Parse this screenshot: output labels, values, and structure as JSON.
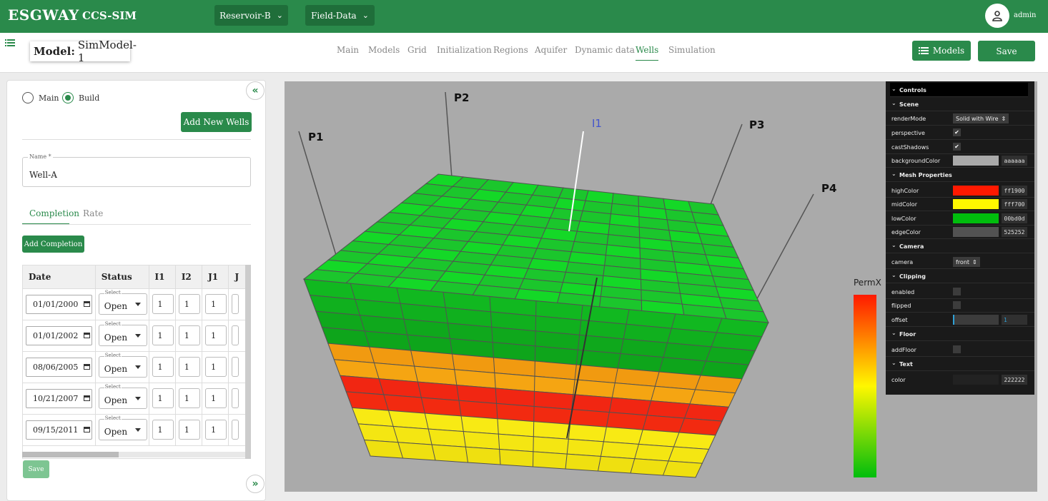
{
  "topbar": {
    "brand": "ESGWAY",
    "subtitle": "CCS-SIM",
    "dropdowns": [
      "Reservoir-B",
      "Field-Data"
    ],
    "user": "admin"
  },
  "navbar": {
    "model_prefix": "Model:",
    "model_name": "SimModel-1",
    "tabs": [
      "Main",
      "Models",
      "Grid",
      "Initialization",
      "Regions",
      "Aquifer",
      "Dynamic data",
      "Wells",
      "Simulation"
    ],
    "active_tab": "Wells",
    "models_button": "Models",
    "save_button": "Save"
  },
  "left": {
    "radio": [
      "Main",
      "Build"
    ],
    "selected_radio": "Build",
    "add_wells": "Add New Wells",
    "name_label": "Name *",
    "name_value": "Well-A",
    "subtabs": [
      "Completion",
      "Rate"
    ],
    "add_completion": "Add Completion",
    "columns": [
      "Date",
      "Status",
      "I1",
      "I2",
      "J1",
      "J"
    ],
    "rows": [
      {
        "date": "01/01/2000",
        "status": "Open",
        "i1": "1",
        "i2": "1",
        "j1": "1"
      },
      {
        "date": "01/01/2002",
        "status": "Open",
        "i1": "1",
        "i2": "1",
        "j1": "1"
      },
      {
        "date": "08/06/2005",
        "status": "Open",
        "i1": "1",
        "i2": "1",
        "j1": "1"
      },
      {
        "date": "10/21/2007",
        "status": "Open",
        "i1": "1",
        "i2": "1",
        "j1": "1"
      },
      {
        "date": "09/15/2011",
        "status": "Open",
        "i1": "1",
        "i2": "1",
        "j1": "1"
      }
    ],
    "select_label": "Select",
    "save": "Save"
  },
  "viewer": {
    "wells": [
      "P1",
      "P2",
      "I1",
      "P3",
      "P4"
    ],
    "colorbar_label": "PermX",
    "colors": {
      "high": "#ff1900",
      "mid": "#fff700",
      "low": "#00bd0d",
      "edge": "#525252",
      "background": "#aaaaaa"
    }
  },
  "controls": {
    "title": "Controls",
    "scene": "Scene",
    "renderMode_k": "renderMode",
    "renderMode_v": "Solid with Wire",
    "perspective": "perspective",
    "castShadows": "castShadows",
    "backgroundColor": "backgroundColor",
    "bg_hex": "aaaaaa",
    "mesh": "Mesh Properties",
    "highColor": "highColor",
    "high_hex": "ff1900",
    "midColor": "midColor",
    "mid_hex": "fff700",
    "lowColor": "lowColor",
    "low_hex": "00bd0d",
    "edgeColor": "edgeColor",
    "edge_hex": "525252",
    "camera_f": "Camera",
    "camera_k": "camera",
    "camera_v": "front",
    "clipping": "Clipping",
    "enabled": "enabled",
    "flipped": "flipped",
    "offset": "offset",
    "offset_v": "1",
    "floor": "Floor",
    "addFloor": "addFloor",
    "text": "Text",
    "color": "color",
    "text_hex": "222222"
  }
}
